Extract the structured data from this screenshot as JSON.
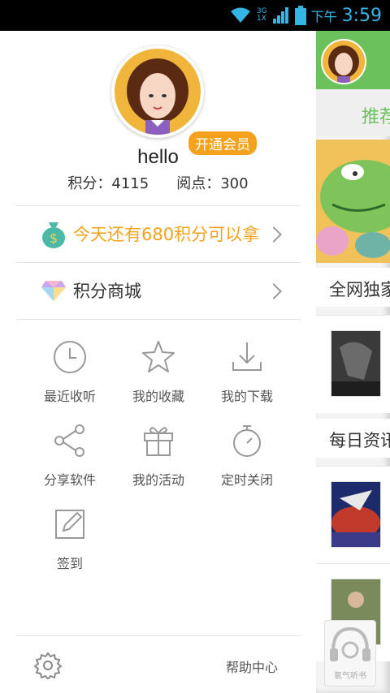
{
  "status_bar": {
    "network_top": "3G",
    "network_bottom": "1X",
    "ampm": "下午",
    "time": "3:59"
  },
  "profile": {
    "username": "hello",
    "vip_label": "开通会员",
    "points_label": "积分：4115",
    "reading_label": "阅点：300"
  },
  "promo": {
    "text": "今天还有680积分可以拿"
  },
  "store": {
    "label": "积分商城"
  },
  "grid": [
    {
      "label": "最近收听",
      "icon": "clock-icon"
    },
    {
      "label": "我的收藏",
      "icon": "star-icon"
    },
    {
      "label": "我的下载",
      "icon": "download-icon"
    },
    {
      "label": "分享软件",
      "icon": "share-icon"
    },
    {
      "label": "我的活动",
      "icon": "gift-icon"
    },
    {
      "label": "定时关闭",
      "icon": "timer-icon"
    },
    {
      "label": "签到",
      "icon": "edit-icon"
    }
  ],
  "footer": {
    "help_label": "帮助中心"
  },
  "content_panel": {
    "tab_label": "推荐",
    "section1": "全网独家",
    "section2": "每日资讯",
    "logo_text": "氧气听书"
  },
  "colors": {
    "accent_orange": "#f4a21e",
    "brand_green": "#6bc15c",
    "status_blue": "#33b5e5"
  }
}
